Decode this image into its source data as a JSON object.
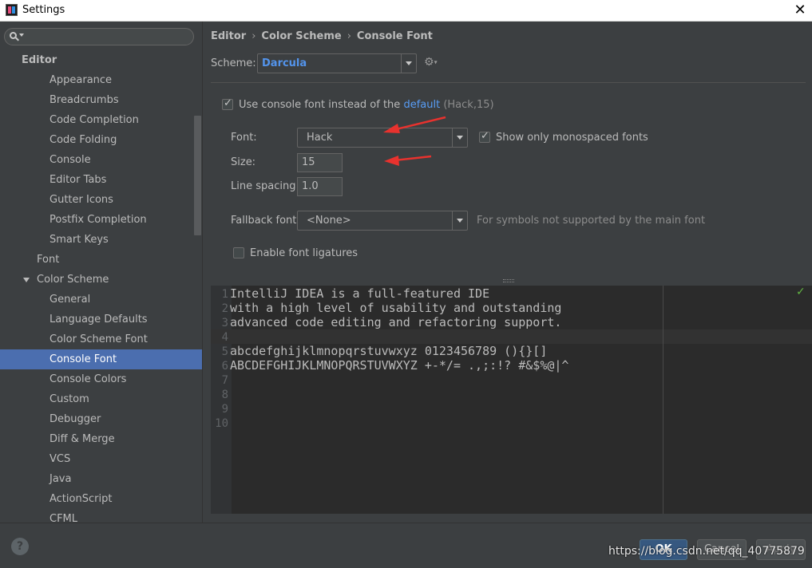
{
  "window": {
    "title": "Settings"
  },
  "sidebar": {
    "items": [
      {
        "label": "Editor",
        "level": 0
      },
      {
        "label": "Appearance",
        "level": 2
      },
      {
        "label": "Breadcrumbs",
        "level": 2
      },
      {
        "label": "Code Completion",
        "level": 2
      },
      {
        "label": "Code Folding",
        "level": 2
      },
      {
        "label": "Console",
        "level": 2
      },
      {
        "label": "Editor Tabs",
        "level": 2
      },
      {
        "label": "Gutter Icons",
        "level": 2
      },
      {
        "label": "Postfix Completion",
        "level": 2
      },
      {
        "label": "Smart Keys",
        "level": 2
      },
      {
        "label": "Font",
        "level": 1
      },
      {
        "label": "Color Scheme",
        "level": 1
      },
      {
        "label": "General",
        "level": 2
      },
      {
        "label": "Language Defaults",
        "level": 2
      },
      {
        "label": "Color Scheme Font",
        "level": 2
      },
      {
        "label": "Console Font",
        "level": 2
      },
      {
        "label": "Console Colors",
        "level": 2
      },
      {
        "label": "Custom",
        "level": 2
      },
      {
        "label": "Debugger",
        "level": 2
      },
      {
        "label": "Diff & Merge",
        "level": 2
      },
      {
        "label": "VCS",
        "level": 2
      },
      {
        "label": "Java",
        "level": 2
      },
      {
        "label": "ActionScript",
        "level": 2
      },
      {
        "label": "CFML",
        "level": 2
      }
    ]
  },
  "breadcrumb": {
    "part1": "Editor",
    "part2": "Color Scheme",
    "part3": "Console Font",
    "sep": "›"
  },
  "scheme": {
    "label": "Scheme:",
    "value": "Darcula"
  },
  "use_console_font": {
    "text": "Use console font instead of the",
    "link": "default",
    "hint": "(Hack,15)"
  },
  "font": {
    "label": "Font:",
    "value": "Hack"
  },
  "monospaced": {
    "label": "Show only monospaced fonts"
  },
  "size": {
    "label": "Size:",
    "value": "15"
  },
  "line_spacing": {
    "label": "Line spacing:",
    "value": "1.0"
  },
  "fallback": {
    "label": "Fallback font:",
    "value": "<None>",
    "hint": "For symbols not supported by the main font"
  },
  "ligatures": {
    "label": "Enable font ligatures"
  },
  "preview": {
    "lines": [
      {
        "n": "1",
        "text": "IntelliJ IDEA is a full-featured IDE"
      },
      {
        "n": "2",
        "text": "with a high level of usability and outstanding"
      },
      {
        "n": "3",
        "text": "advanced code editing and refactoring support."
      },
      {
        "n": "4",
        "text": ""
      },
      {
        "n": "5",
        "text": "abcdefghijklmnopqrstuvwxyz 0123456789 (){}[]"
      },
      {
        "n": "6",
        "text": "ABCDEFGHIJKLMNOPQRSTUVWXYZ +-*/= .,;:!? #&$%@|^"
      },
      {
        "n": "7",
        "text": ""
      },
      {
        "n": "8",
        "text": ""
      },
      {
        "n": "9",
        "text": ""
      },
      {
        "n": "10",
        "text": ""
      }
    ]
  },
  "buttons": {
    "help": "?",
    "ok": "OK",
    "cancel": "Cancel",
    "apply": "Apply"
  },
  "watermark": "https://blog.csdn.net/qq_40775879",
  "colors": {
    "selection": "#4b6eaf",
    "link": "#589df6",
    "annotation_arrow": "#e8322e"
  }
}
